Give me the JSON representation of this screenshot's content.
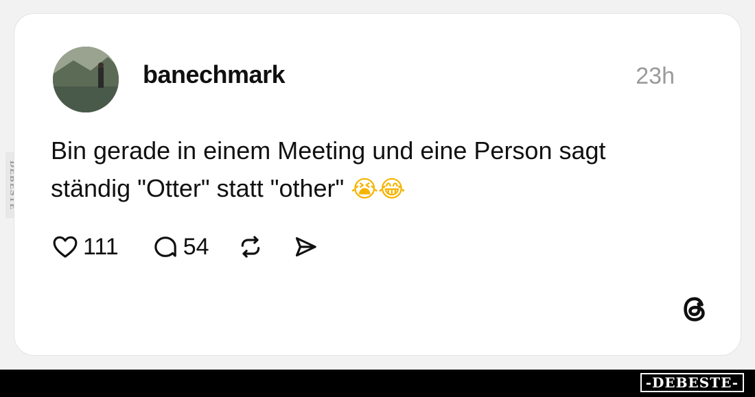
{
  "post": {
    "username": "banechmark",
    "time": "23h",
    "text_line1": "Bin gerade in einem Meeting und eine Person sagt",
    "text_line2": "ständig \"Otter\" statt \"other\"",
    "emojis": "😭😂"
  },
  "actions": {
    "likes": "111",
    "comments": "54"
  },
  "icons": [
    "heart-icon",
    "comment-icon",
    "repost-icon",
    "share-icon",
    "threads-logo-icon"
  ],
  "watermark": {
    "side": "DEBESTE",
    "bottom": "-DEBESTE-"
  },
  "colors": {
    "background": "#f2f2f2",
    "card": "#ffffff",
    "text": "#101010",
    "muted": "#9a9a9a",
    "bottom_bar": "#000000"
  }
}
